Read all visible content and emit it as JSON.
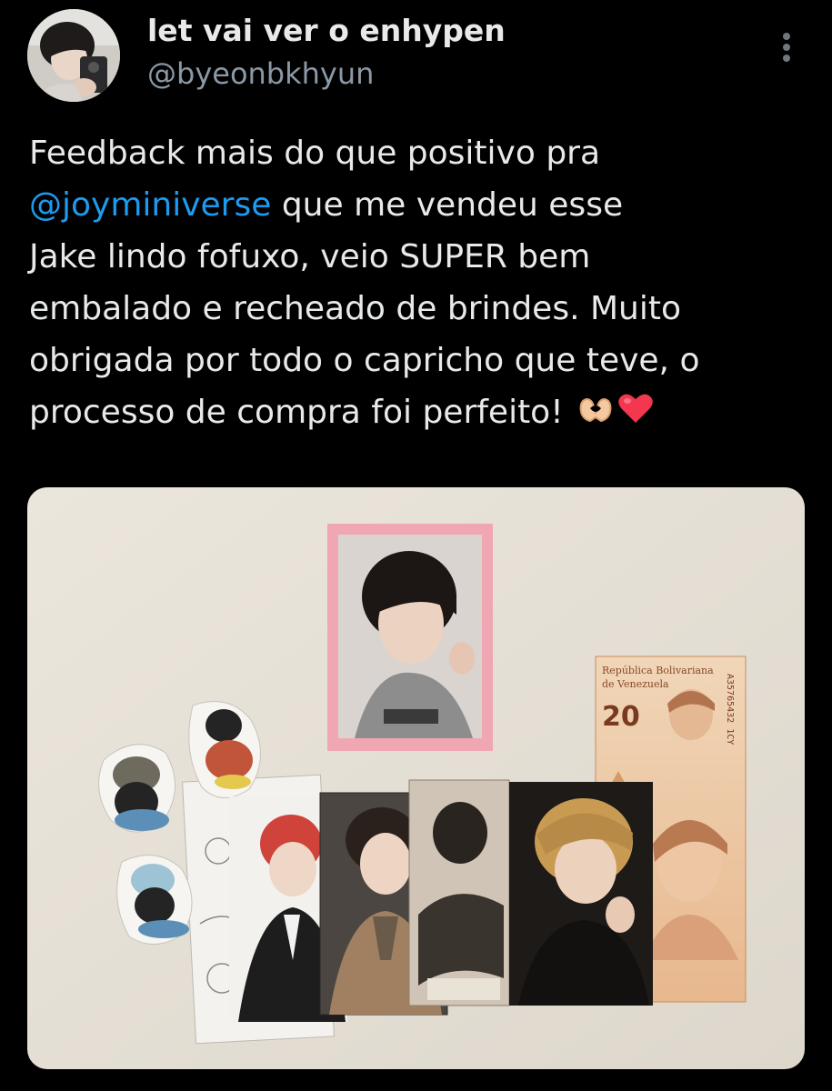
{
  "tweet": {
    "display_name": "let vai ver o enhypen",
    "handle": "@byeonbkhyun",
    "more_icon": "more-vertical-icon",
    "text_lines": [
      {
        "before": "Feedback mais do que positivo pra",
        "mention": "",
        "after": ""
      },
      {
        "before": "",
        "mention": "@joyminiverse",
        "after": " que me vendeu esse"
      },
      {
        "before": "Jake lindo fofuxo, veio SUPER bem",
        "mention": "",
        "after": ""
      },
      {
        "before": "embalado e recheado de brindes. Muito",
        "mention": "",
        "after": ""
      },
      {
        "before": "obrigada por todo o capricho que teve, o",
        "mention": "",
        "after": ""
      },
      {
        "before": "processo de compra foi perfeito! ",
        "mention": "",
        "after": ""
      }
    ],
    "emojis": [
      "heart-hands-icon",
      "red-heart-icon"
    ],
    "banknote": {
      "issuer_line1": "República Bolivariana",
      "issuer_line2": "de Venezuela",
      "denomination": "20",
      "serial": "A35765432 1CY"
    },
    "colors": {
      "mention": "#1d9bf0",
      "handle": "#8b98a5",
      "text": "#e7e9ea",
      "background": "#000000"
    }
  }
}
